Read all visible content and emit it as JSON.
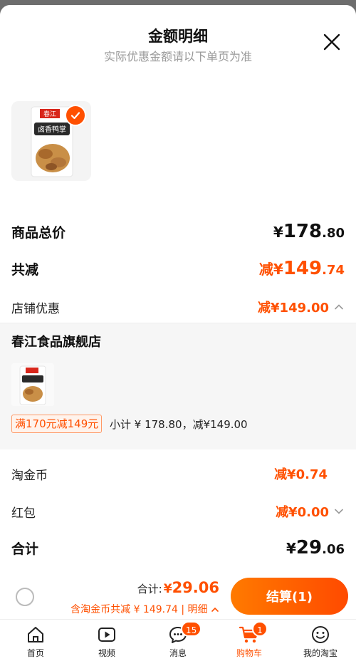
{
  "header": {
    "title": "金额明细",
    "subtitle": "实际优惠金额请以下单页为准"
  },
  "product": {
    "brand_logo_text": "春江",
    "package_text": "卤香鸭掌"
  },
  "summary": {
    "total_price_label": "商品总价",
    "total_price_currency": "¥",
    "total_price_int": "178",
    "total_price_dec": ".80",
    "total_discount_label": "共减",
    "total_discount_prefix": "减¥",
    "total_discount_int": "149",
    "total_discount_dec": ".74",
    "store_discount_label": "店铺优惠",
    "store_discount_value": "减¥149.00"
  },
  "store": {
    "name": "春江食品旗舰店",
    "promo_tag": "满170元减149元",
    "subtotal": "小计 ¥ 178.80，减¥149.00"
  },
  "taojinbi": {
    "label": "淘金币",
    "value": "减¥0.74"
  },
  "hongbao": {
    "label": "红包",
    "value": "减¥0.00"
  },
  "grand_total": {
    "label": "合计",
    "currency": "¥",
    "int": "29",
    "dec": ".06"
  },
  "bottom_bar": {
    "total_label": "合计:",
    "total_currency": "¥",
    "total_value": "29.06",
    "coin_note": "含淘金币共减 ¥ 149.74 | 明细",
    "checkout_label": "结算(1)"
  },
  "tabs": [
    {
      "label": "首页",
      "icon": "home-icon"
    },
    {
      "label": "视频",
      "icon": "video-icon"
    },
    {
      "label": "消息",
      "icon": "message-icon",
      "badge": "15"
    },
    {
      "label": "购物车",
      "icon": "cart-icon",
      "badge": "1",
      "active": true
    },
    {
      "label": "我的淘宝",
      "icon": "profile-icon"
    }
  ],
  "colors": {
    "accent": "#ff5000",
    "backdrop": "#6d6d6d"
  }
}
